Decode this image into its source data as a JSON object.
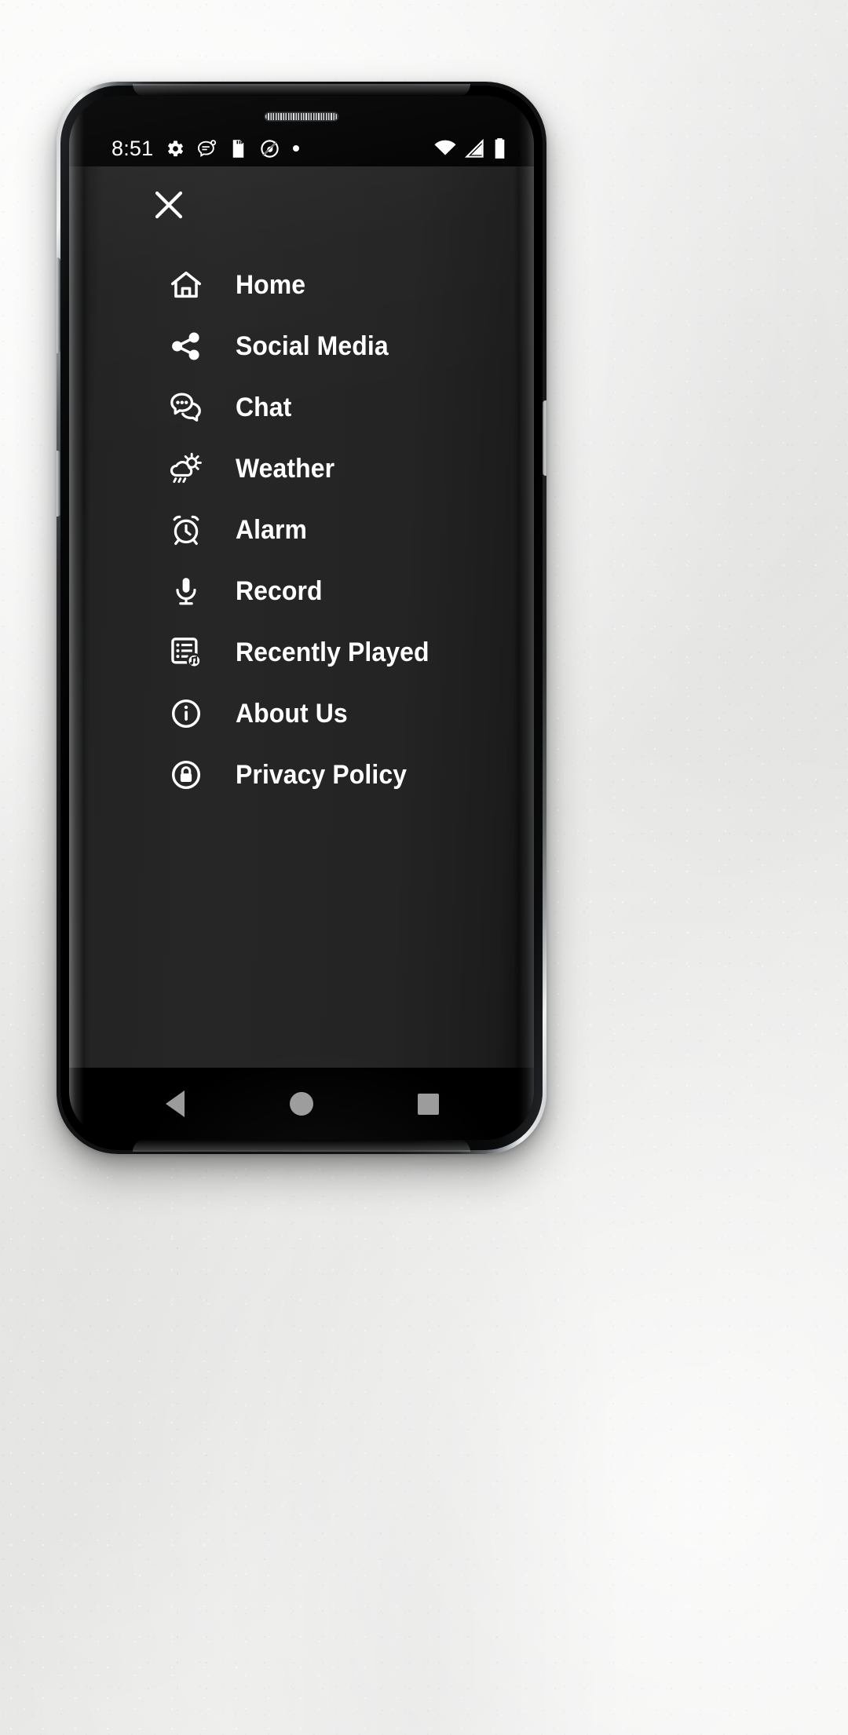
{
  "device": {
    "type": "smartphone",
    "os": "android"
  },
  "status_bar": {
    "time": "8:51",
    "left_icons": [
      "settings-gear-icon",
      "message-bubble-icon",
      "sd-card-icon",
      "sync-disabled-icon",
      "dot-icon"
    ],
    "right_icons": [
      "wifi-icon",
      "signal-icon",
      "battery-icon"
    ]
  },
  "drawer": {
    "close_label": "✕",
    "close_icon": "close-icon",
    "background_color": "#242424",
    "text_color": "#ffffff",
    "items": [
      {
        "label": "Home",
        "icon": "home-icon"
      },
      {
        "label": "Social Media",
        "icon": "share-icon"
      },
      {
        "label": "Chat",
        "icon": "chat-bubbles-icon"
      },
      {
        "label": "Weather",
        "icon": "sun-cloud-rain-icon"
      },
      {
        "label": "Alarm",
        "icon": "alarm-clock-icon"
      },
      {
        "label": "Record",
        "icon": "microphone-icon"
      },
      {
        "label": "Recently Played",
        "icon": "playlist-music-icon"
      },
      {
        "label": "About Us",
        "icon": "info-circle-icon"
      },
      {
        "label": "Privacy Policy",
        "icon": "lock-circle-icon"
      }
    ]
  },
  "nav_bar": {
    "icon_color": "#9b9b9b",
    "buttons": [
      {
        "name": "back",
        "icon": "back-triangle-icon"
      },
      {
        "name": "home",
        "icon": "home-circle-icon"
      },
      {
        "name": "recents",
        "icon": "recents-square-icon"
      }
    ]
  }
}
